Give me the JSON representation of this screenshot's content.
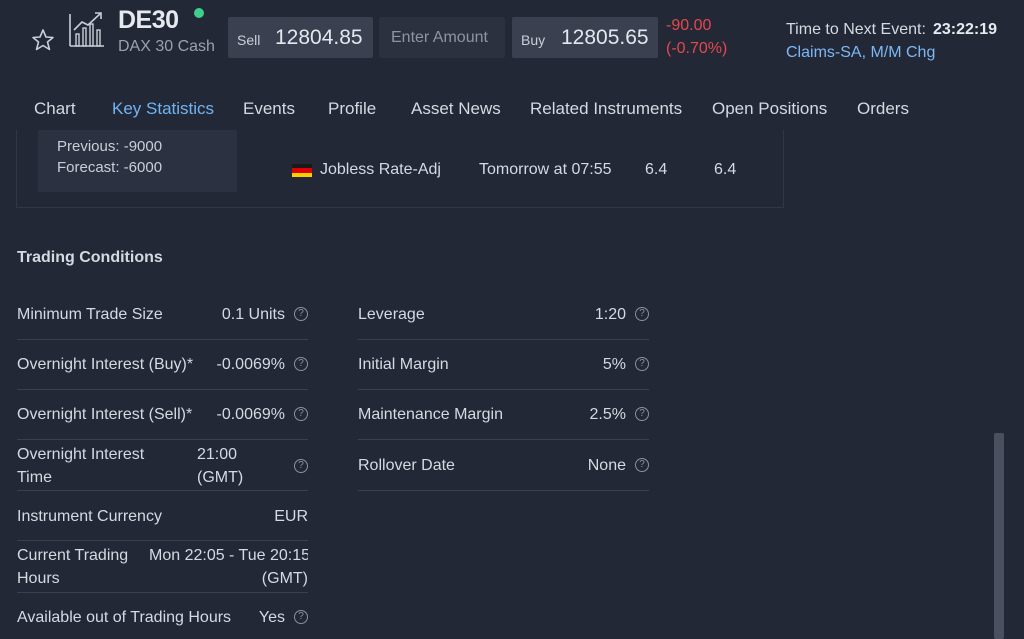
{
  "instrument": {
    "symbol": "DE30",
    "name": "DAX 30 Cash",
    "status_color": "#3ecf8e"
  },
  "trade": {
    "sell_label": "Sell",
    "sell_price": "12804.85",
    "amount_placeholder": "Enter Amount",
    "buy_label": "Buy",
    "buy_price": "12805.65",
    "change_abs": "-90.00",
    "change_pct": "(-0.70%)",
    "change_color": "#e5484d"
  },
  "next_event": {
    "label": "Time to Next Event:",
    "countdown": "23:22:19",
    "event_name": "Claims-SA, M/M Chg"
  },
  "tabs": [
    {
      "label": "Chart"
    },
    {
      "label": "Key Statistics",
      "active": true
    },
    {
      "label": "Events"
    },
    {
      "label": "Profile"
    },
    {
      "label": "Asset News"
    },
    {
      "label": "Related Instruments"
    },
    {
      "label": "Open Positions"
    },
    {
      "label": "Orders"
    }
  ],
  "events_panel": {
    "previous": "Previous: -9000",
    "forecast": "Forecast: -6000",
    "rows": [
      {
        "flag": "germany-flag-icon",
        "event": "Jobless Rate-Adj",
        "time": "Tomorrow at 07:55",
        "forecast": "6.4",
        "previous": "6.4"
      }
    ]
  },
  "trading_conditions": {
    "title": "Trading Conditions",
    "left": [
      {
        "label": "Minimum Trade Size",
        "value": "0.1 Units",
        "help": true
      },
      {
        "label": "Overnight Interest (Buy)*",
        "value": "-0.0069%",
        "help": true
      },
      {
        "label": "Overnight Interest (Sell)*",
        "value": "-0.0069%",
        "help": true
      },
      {
        "label_line1": "Overnight Interest",
        "label_line2": "Time",
        "value_line1": "21:00",
        "value_line2": "(GMT)",
        "help": true
      },
      {
        "label": "Instrument Currency",
        "value": "EUR",
        "help": false
      },
      {
        "label_line1": "Current Trading",
        "label_line2": "Hours",
        "value_line1": "Mon 22:05 - Tue 20:15",
        "value_line2": "(GMT)",
        "help": false
      },
      {
        "label": "Available out of Trading Hours",
        "value": "Yes",
        "help": true
      }
    ],
    "right": [
      {
        "label": "Leverage",
        "value": "1:20",
        "help": true
      },
      {
        "label": "Initial Margin",
        "value": "5%",
        "help": true
      },
      {
        "label": "Maintenance Margin",
        "value": "2.5%",
        "help": true
      },
      {
        "label": "Rollover Date",
        "value": "None",
        "help": true
      }
    ]
  }
}
